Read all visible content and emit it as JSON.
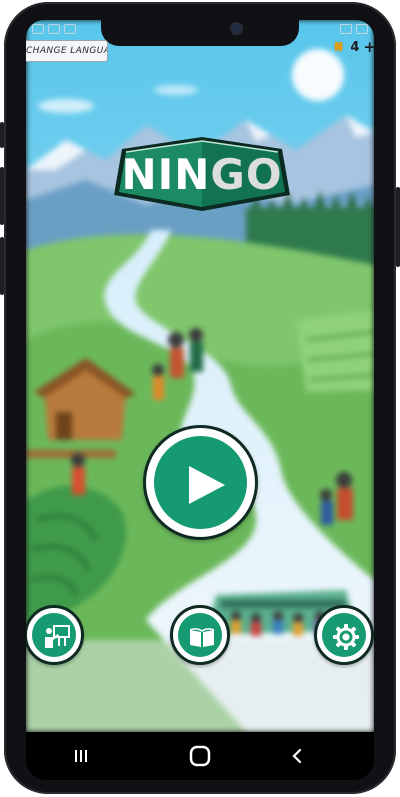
{
  "top_bar": {
    "language_button_label": "CHANGE LANGUAGE",
    "coin_count": "4",
    "coin_add_label": "+"
  },
  "logo": {
    "text_part1": "NIN",
    "text_part2": "GO"
  },
  "main": {
    "play_button": {
      "icon": "play-icon"
    }
  },
  "bottom_actions": [
    {
      "name": "teacher-button",
      "icon": "teacher-icon"
    },
    {
      "name": "book-button",
      "icon": "book-icon"
    },
    {
      "name": "settings-button",
      "icon": "gear-icon"
    }
  ],
  "navigation": {
    "recents_icon": "recents-icon",
    "home_icon": "home-icon",
    "back_icon": "back-icon"
  },
  "colors": {
    "primary_green": "#169a72",
    "button_outline": "#0e2a22",
    "coin_gold": "#e8a10c"
  }
}
